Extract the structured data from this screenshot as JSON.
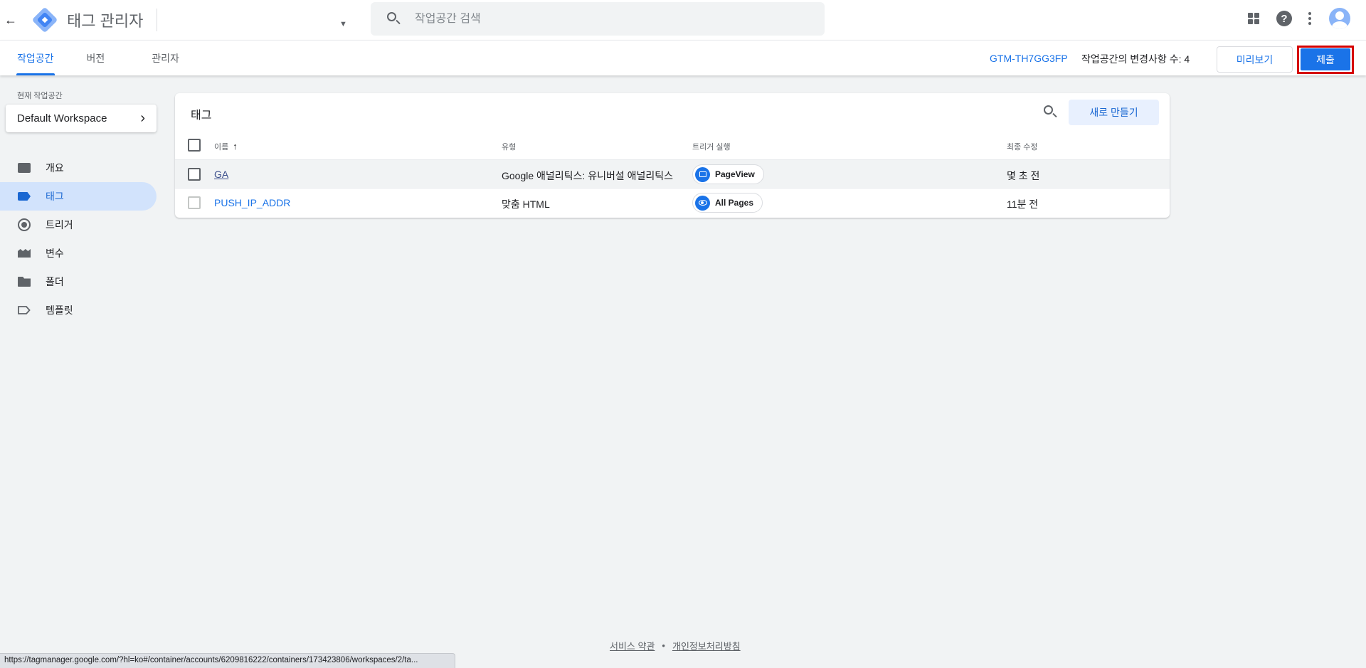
{
  "header": {
    "app_title": "태그 관리자",
    "search_placeholder": "작업공간 검색"
  },
  "tabs": [
    {
      "label": "작업공간",
      "active": true
    },
    {
      "label": "버전"
    },
    {
      "label": "관리자"
    }
  ],
  "toolbar": {
    "container_id": "GTM-TH7GG3FP",
    "changes_label": "작업공간의 변경사항 수: 4",
    "preview_label": "미리보기",
    "submit_label": "제출"
  },
  "sidebar": {
    "current_ws_label": "현재 작업공간",
    "workspace_name": "Default Workspace",
    "items": [
      {
        "label": "개요",
        "icon": "overview-icon"
      },
      {
        "label": "태그",
        "icon": "tag-icon",
        "active": true
      },
      {
        "label": "트리거",
        "icon": "trigger-icon"
      },
      {
        "label": "변수",
        "icon": "variable-icon"
      },
      {
        "label": "폴더",
        "icon": "folder-icon"
      },
      {
        "label": "템플릿",
        "icon": "template-icon"
      }
    ]
  },
  "tags_panel": {
    "title": "태그",
    "new_button": "새로 만들기",
    "columns": {
      "name": "이름",
      "sort_glyph": "↑",
      "type": "유형",
      "trigger": "트리거 실행",
      "modified": "최종 수정"
    },
    "rows": [
      {
        "name": "GA",
        "type": "Google 애널리틱스: 유니버설 애널리틱스",
        "trigger": "PageView",
        "trigger_icon": "pageview-icon",
        "modified": "몇 초 전"
      },
      {
        "name": "PUSH_IP_ADDR",
        "type": "맞춤 HTML",
        "trigger": "All Pages",
        "trigger_icon": "eye-icon",
        "modified": "11분 전"
      }
    ]
  },
  "footer": {
    "terms": "서비스 약관",
    "separator": "•",
    "privacy": "개인정보처리방침"
  },
  "status_url": "https://tagmanager.google.com/?hl=ko#/container/accounts/6209816222/containers/173423806/workspaces/2/ta...",
  "colors": {
    "accent": "#1a73e8",
    "active_nav_bg": "#d2e3fc",
    "submit_highlight": "#d50000"
  }
}
